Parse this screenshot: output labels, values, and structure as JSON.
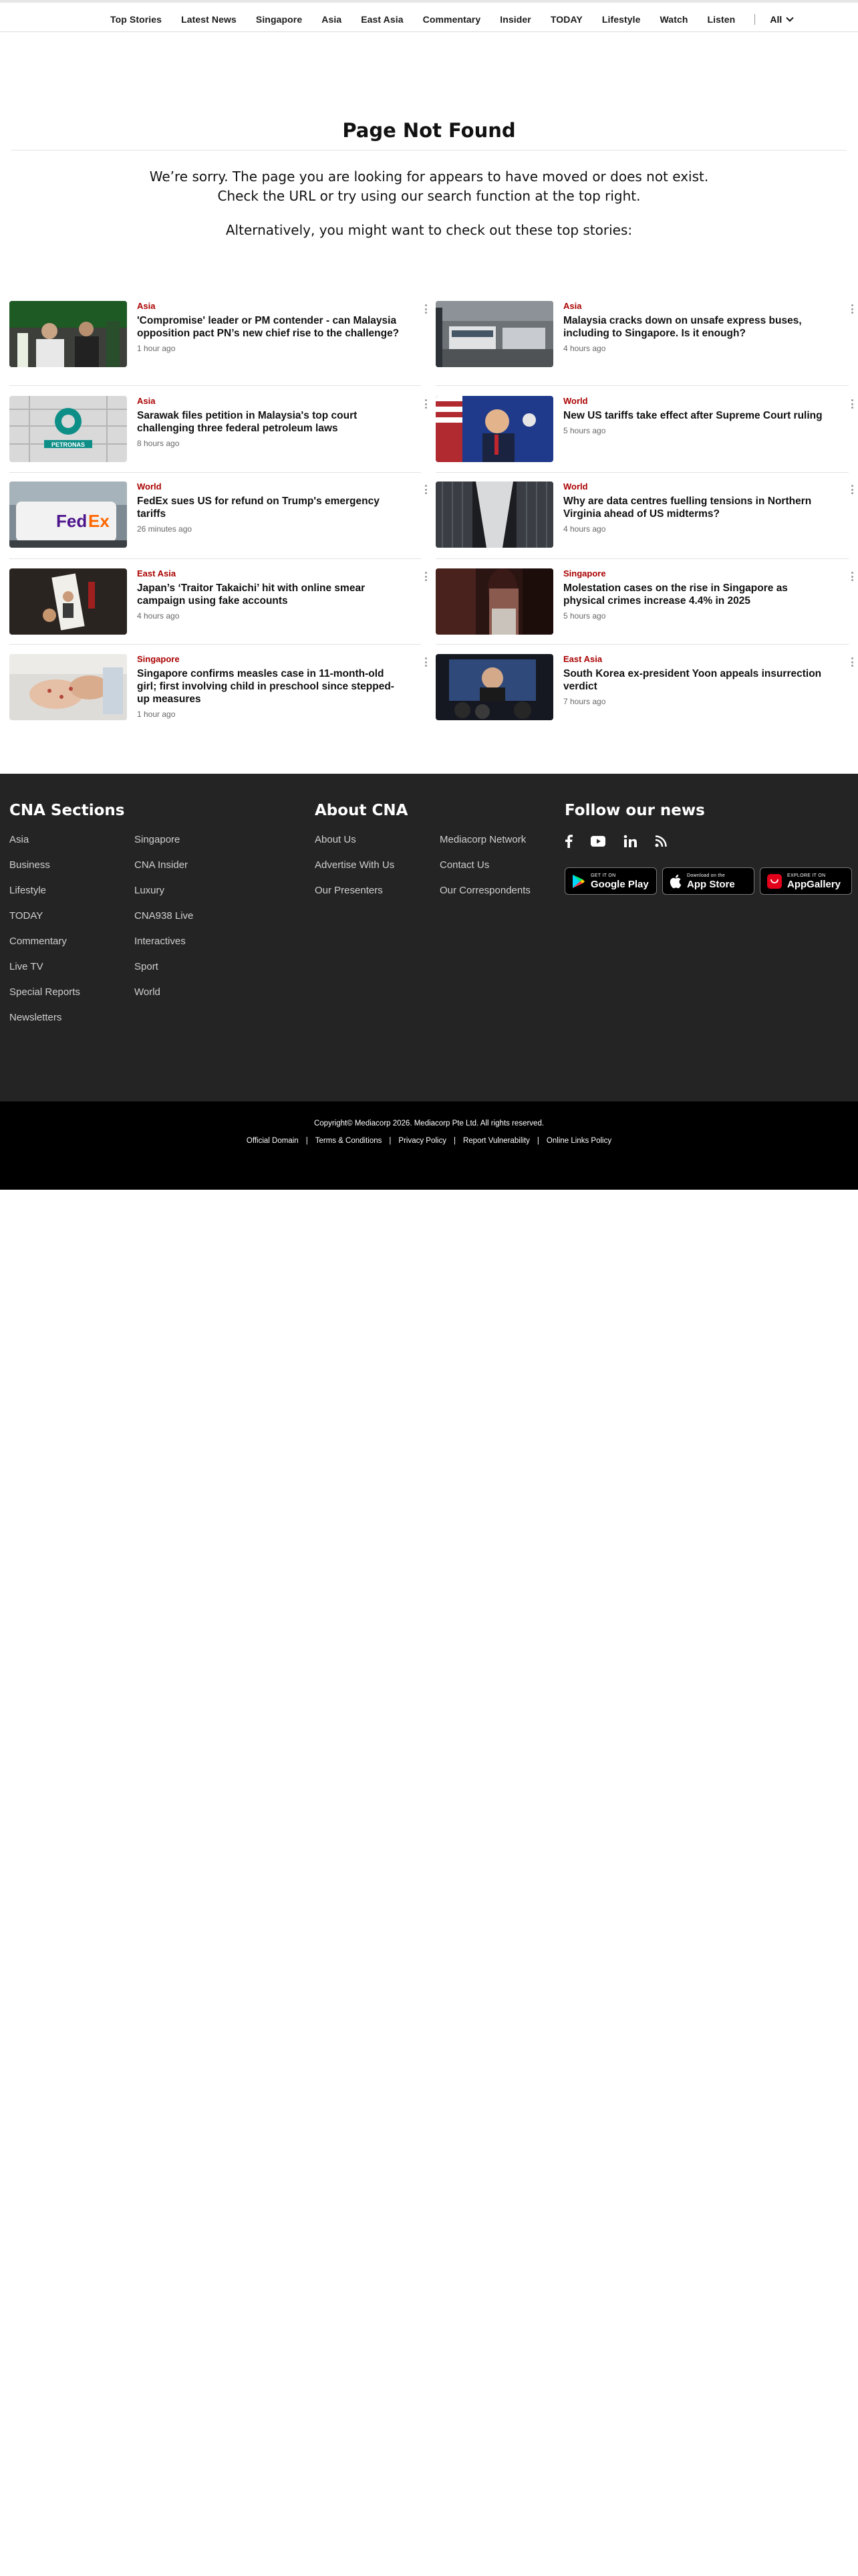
{
  "nav": {
    "items": [
      "Top Stories",
      "Latest News",
      "Singapore",
      "Asia",
      "East Asia",
      "Commentary",
      "Insider",
      "TODAY",
      "Lifestyle",
      "Watch",
      "Listen"
    ],
    "all_label": "All"
  },
  "not_found": {
    "title": "Page Not Found",
    "line1": "We’re sorry. The page you are looking for appears to have moved or does not exist.",
    "line2": "Check the URL or try using our search function at the top right.",
    "alt": "Alternatively, you might want to check out these top stories:"
  },
  "stories": [
    {
      "category": "Asia",
      "headline": "'Compromise' leader or PM contender - can Malaysia opposition pact PN’s new chief rise to the challenge?",
      "time": "1 hour ago"
    },
    {
      "category": "Asia",
      "headline": "Malaysia cracks down on unsafe express buses, including to Singapore. Is it enough?",
      "time": "4 hours ago"
    },
    {
      "category": "Asia",
      "headline": "Sarawak files petition in Malaysia's top court challenging three federal petroleum laws",
      "time": "8 hours ago"
    },
    {
      "category": "World",
      "headline": "New US tariffs take effect after Supreme Court ruling",
      "time": "5 hours ago"
    },
    {
      "category": "World",
      "headline": "FedEx sues US for refund on Trump's emergency tariffs",
      "time": "26 minutes ago"
    },
    {
      "category": "World",
      "headline": "Why are data centres fuelling tensions in Northern Virginia ahead of US midterms?",
      "time": "4 hours ago"
    },
    {
      "category": "East Asia",
      "headline": "Japan’s ‘Traitor Takaichi’ hit with online smear campaign using fake accounts",
      "time": "4 hours ago"
    },
    {
      "category": "Singapore",
      "headline": "Molestation cases on the rise in Singapore as physical crimes increase 4.4% in 2025",
      "time": "5 hours ago"
    },
    {
      "category": "Singapore",
      "headline": "Singapore confirms measles case in 11-month-old girl; first involving child in preschool since stepped-up measures",
      "time": "1 hour ago"
    },
    {
      "category": "East Asia",
      "headline": "South Korea ex-president Yoon appeals insurrection verdict",
      "time": "7 hours ago"
    }
  ],
  "footer": {
    "sections_title": "CNA Sections",
    "sections_col1": [
      "Asia",
      "Business",
      "Lifestyle",
      "TODAY",
      "Commentary",
      "Live TV",
      "Special Reports",
      "Newsletters"
    ],
    "sections_col2": [
      "Singapore",
      "CNA Insider",
      "Luxury",
      "CNA938 Live",
      "Interactives",
      "Sport",
      "World"
    ],
    "about_title": "About CNA",
    "about_col1": [
      "About Us",
      "Advertise With Us",
      "Our Presenters"
    ],
    "about_col2": [
      "Mediacorp Network",
      "Contact Us",
      "Our Correspondents"
    ],
    "follow_title": "Follow our news",
    "social_icons": [
      "facebook-icon",
      "youtube-icon",
      "linkedin-icon",
      "rss-icon"
    ],
    "badges": [
      {
        "small": "GET IT ON",
        "big": "Google Play"
      },
      {
        "small": "Download on the",
        "big": "App Store"
      },
      {
        "small": "EXPLORE IT ON",
        "big": "AppGallery"
      }
    ]
  },
  "bottom": {
    "copyright": "Copyright© Mediacorp 2026. Mediacorp Pte Ltd. All rights reserved.",
    "links": [
      "Official Domain",
      "Terms & Conditions",
      "Privacy Policy",
      "Report Vulnerability",
      "Online Links Policy"
    ]
  }
}
